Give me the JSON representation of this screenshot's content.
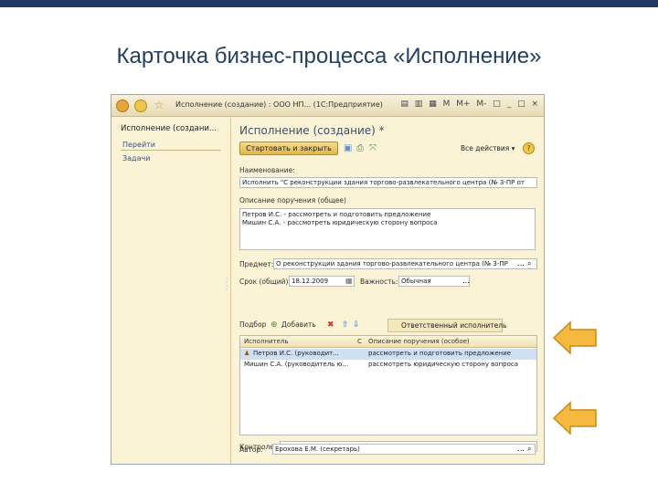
{
  "slide": {
    "title": "Карточка бизнес-процесса «Исполнение»"
  },
  "window": {
    "caption": "Исполнение (создание) : ООО НП... (1С:Предприятие)",
    "toolbar_icons": [
      "▤",
      "▥",
      "▦",
      "M",
      "M+",
      "M-",
      "□",
      "_",
      "□",
      "×"
    ]
  },
  "left_pane": {
    "title": "Исполнение (создани...",
    "links": [
      "Перейти",
      "Задачи"
    ]
  },
  "form": {
    "title": "Исполнение (создание) *",
    "primary_button": "Стартовать и закрыть",
    "all_actions": "Все действия ▾",
    "help": "?",
    "name_label": "Наименование:",
    "name_value": "Исполнить \"С реконструкции здания торгово-развлекательного центра (№ 3-ПР от",
    "desc_label": "Описание поручения (общее)",
    "desc_lines": [
      "Петров И.С. - рассмотреть и подготовить предложение",
      "Мишин С.А. - рассмотреть юридическую сторону вопроса"
    ],
    "subject_label": "Предмет:",
    "subject_value": "О реконструкции здания торгово-развлекательного центра (№ 3-ПР",
    "deadline_label": "Срок (общий):",
    "deadline_value": "18.12.2009",
    "importance_label": "Важность:",
    "importance_value": "Обычная",
    "tabs": {
      "pick": "Подбор",
      "add": "Добавить",
      "active": "Ответственный исполнитель"
    },
    "table": {
      "headers": [
        "Исполнитель",
        "С",
        "Описание поручения (особое)"
      ],
      "rows": [
        [
          "Петров И.С. (руководит...",
          "",
          "рассмотреть и подготовить предложение"
        ],
        [
          "Мишин С.А. (руководитель ю...",
          "",
          "рассмотреть юридическую сторону вопроса"
        ]
      ]
    },
    "controller_label": "Контролер:",
    "controller_value": "Ерохова Е.М. (секретарь)",
    "author_label": "Автор:",
    "author_value": "Ерохова Е.М. (секретарь)"
  },
  "colors": {
    "accent_bar": "#1f3864",
    "title_text": "#243f60",
    "window_bg": "#fbf3d6",
    "arrow_fill": "#f4b93e",
    "arrow_stroke": "#c98a1a"
  }
}
